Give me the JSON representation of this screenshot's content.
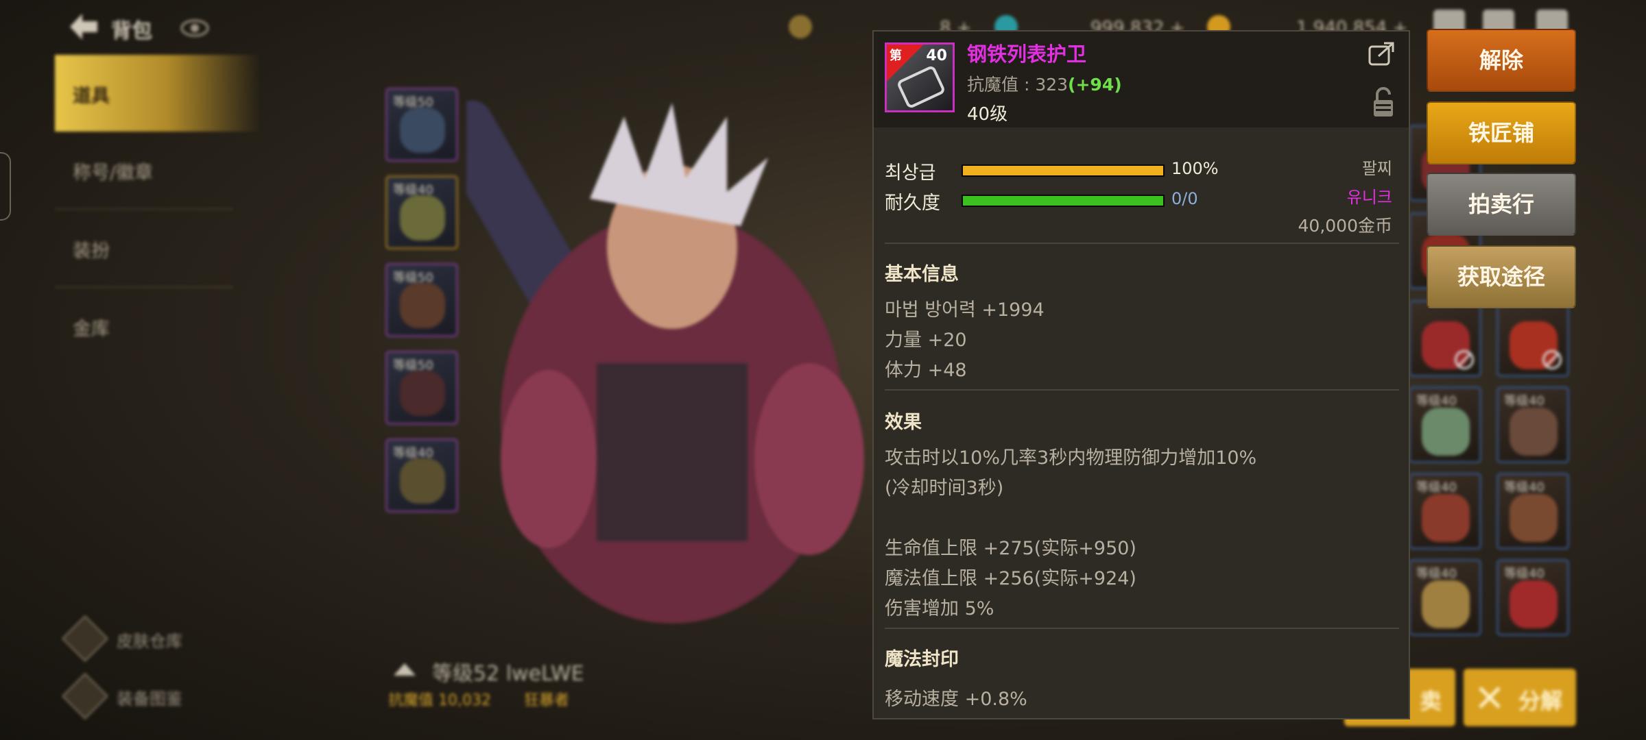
{
  "topbar": {
    "title": "背包",
    "back_icon": "back-arrow-icon",
    "currency_1": "8 +",
    "currency_2": "999,832 +",
    "currency_3": "1,940,854 +"
  },
  "sidebar": {
    "items": [
      {
        "label": "道具",
        "active": true
      },
      {
        "label": "称号/徽章",
        "active": false
      },
      {
        "label": "装扮",
        "active": false
      },
      {
        "label": "金库",
        "active": false
      }
    ],
    "bottom_links": [
      {
        "label": "皮肤仓库",
        "icon": "wardrobe-icon"
      },
      {
        "label": "装备图鉴",
        "icon": "codex-icon"
      }
    ]
  },
  "equipment_slots": [
    {
      "level": "等级50",
      "color": "#6c3a7a"
    },
    {
      "level": "等级40",
      "color": "#8a6a20"
    },
    {
      "level": "等级50",
      "color": "#6c3a7a"
    },
    {
      "level": "等级50",
      "color": "#6c3a7a"
    },
    {
      "level": "等级40",
      "color": "#6c3a7a"
    }
  ],
  "character": {
    "level_name": "等级52 lweLWE",
    "power": "抗魔值 10,032",
    "class": "狂暴者"
  },
  "inventory": {
    "cells": [
      {
        "level": "",
        "banned": false
      },
      {
        "level": "",
        "banned": false
      },
      {
        "level": "",
        "banned": true
      },
      {
        "level": "",
        "banned": true
      },
      {
        "level": "等级40",
        "banned": false
      },
      {
        "level": "等级40",
        "banned": false
      },
      {
        "level": "等级40",
        "banned": false
      },
      {
        "level": "等级40",
        "banned": false
      },
      {
        "level": "等级40",
        "banned": false
      },
      {
        "level": "等级40",
        "banned": false
      }
    ],
    "bottom_btn_1": "卖",
    "bottom_btn_2": "分解"
  },
  "tooltip": {
    "item_name": "钢铁列表护卫",
    "icon_tier_text": "第",
    "icon_level": "40",
    "mdef_label": "抗魔值 : 323",
    "mdef_bonus": "(+94)",
    "req_level": "40级",
    "grade_label": "최상급",
    "grade_value": "100%",
    "grade_fill": 1.0,
    "durability_label": "耐久度",
    "durability_value": "0/0",
    "durability_fill": 1.0,
    "slot_type": "팔찌",
    "rarity": "유니크",
    "price": "40,000金币",
    "section_basic": "基本信息",
    "basic_lines": [
      "마법 방어력 +1994",
      "力量 +20",
      "体力 +48"
    ],
    "section_effect": "效果",
    "effect_lines": [
      "攻击时以10%几率3秒内物理防御力增加10%",
      "(冷却时间3秒)",
      "",
      "生命值上限 +275(实际+950)",
      "魔法值上限 +256(实际+924)",
      "伤害增加 5%"
    ],
    "section_seal": "魔法封印",
    "seal_line": "移动速度 +0.8%",
    "colors": {
      "name": "#e030e0",
      "bonus": "#6fe04a",
      "grade_bar": "#f0b020",
      "durability_bar": "#3cc020"
    }
  },
  "actions": {
    "release": "解除",
    "smith": "铁匠铺",
    "auction": "拍卖行",
    "source": "获取途径"
  }
}
